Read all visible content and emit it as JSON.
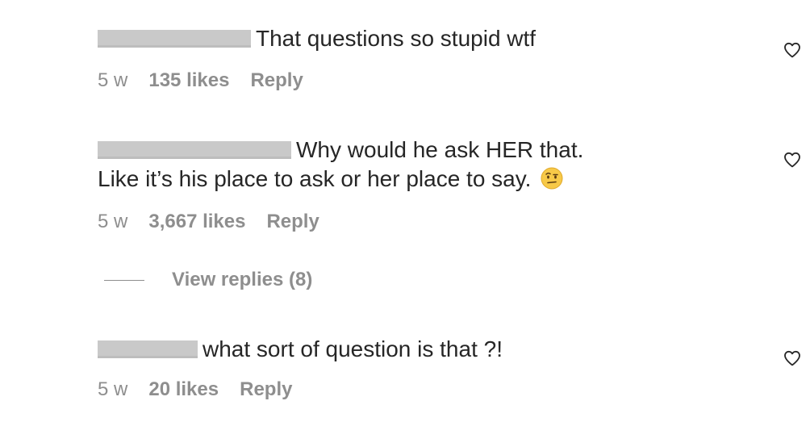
{
  "comments": [
    {
      "text": "That questions so stupid wtf",
      "age": "5 w",
      "likes": "135 likes",
      "reply": "Reply"
    },
    {
      "text_line1": "Why would he ask HER that.",
      "text_line2": "Like it’s his place to ask or her place to say.",
      "emoji": "face-with-raised-eyebrow-emoji",
      "age": "5 w",
      "likes": "3,667 likes",
      "reply": "Reply",
      "view_replies": "View replies (8)"
    },
    {
      "text": "what sort of question is that ?!",
      "age": "5 w",
      "likes": "20 likes",
      "reply": "Reply"
    }
  ],
  "icons": {
    "like": "heart-outline-icon"
  },
  "colors": {
    "text_primary": "#262626",
    "text_secondary": "#8e8e8e",
    "redaction": "#c9c9c9"
  }
}
